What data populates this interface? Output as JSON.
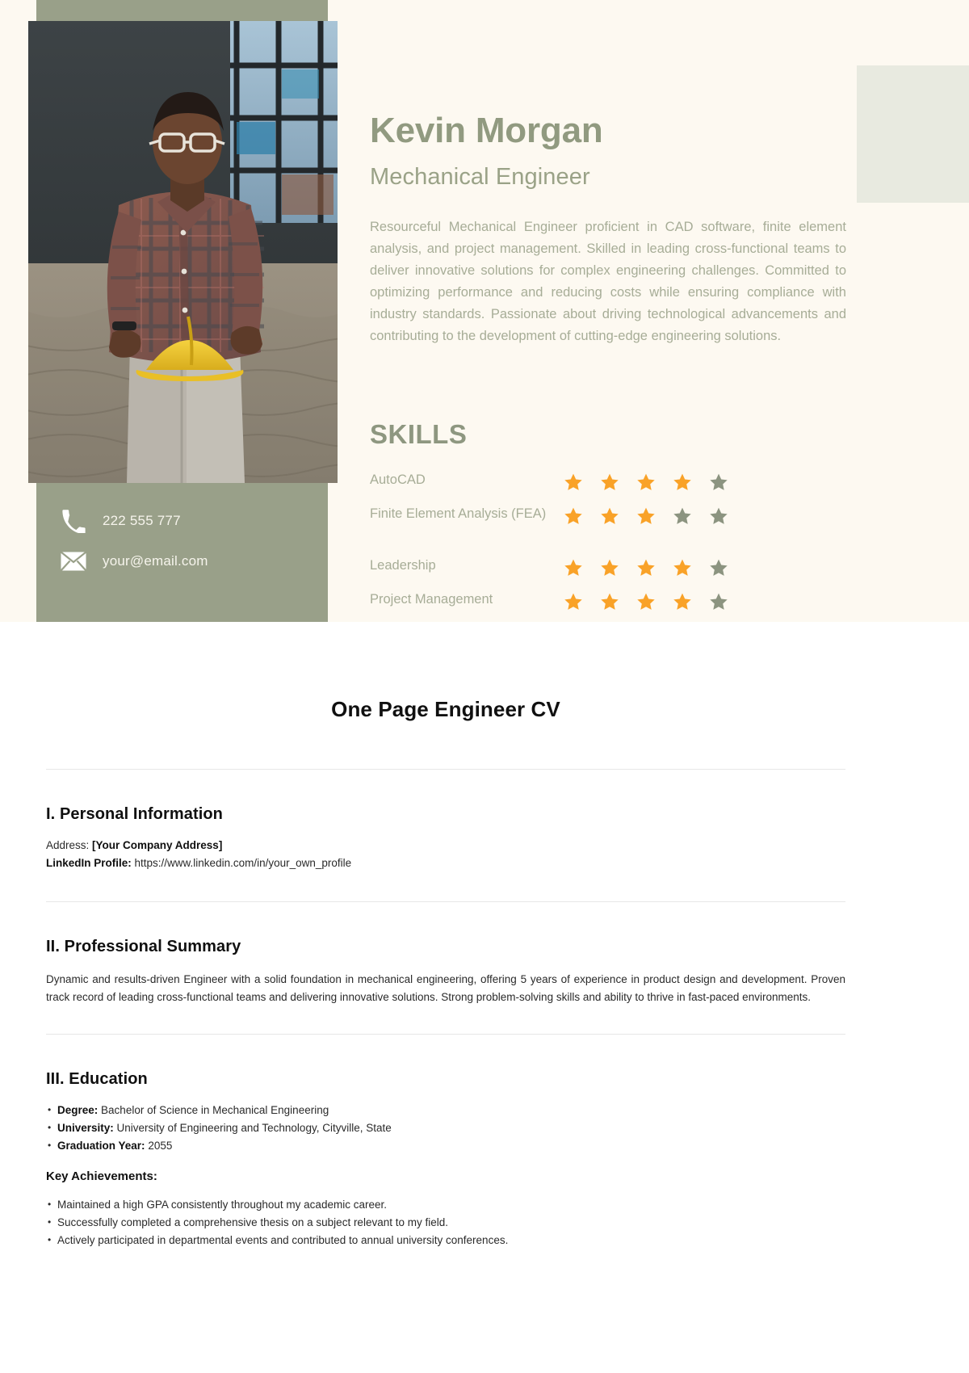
{
  "resume_preview": {
    "name": "Kevin Morgan",
    "role": "Mechanical Engineer",
    "bio": "Resourceful Mechanical Engineer proficient in CAD software, finite element analysis, and project management. Skilled in leading cross-functional teams to deliver innovative solutions for complex engineering challenges. Committed to optimizing performance and reducing costs while ensuring compliance with industry standards. Passionate about driving technological advancements and contributing to the development of cutting-edge engineering solutions.",
    "contact": {
      "phone": "222 555 777",
      "phone_icon": "phone-icon",
      "email": "your@email.com",
      "email_icon": "envelope-icon"
    },
    "skills_heading": "SKILLS",
    "skills": [
      {
        "label": "AutoCAD",
        "rating": 4,
        "max": 5
      },
      {
        "label": "Finite Element Analysis (FEA)",
        "rating": 3,
        "max": 5
      },
      {
        "label": "Leadership",
        "rating": 4,
        "max": 5
      },
      {
        "label": "Project Management",
        "rating": 4,
        "max": 5
      }
    ],
    "colors": {
      "sage": "#99a089",
      "cream": "#fdf9f1",
      "deco": "#e8eae0",
      "star_filled": "#f9a228",
      "star_empty": "#8c9480",
      "heading": "#919a80",
      "body": "#a7ad97"
    }
  },
  "document": {
    "title": "One Page Engineer CV",
    "sections": {
      "personal": {
        "heading": "I. Personal Information",
        "address_label": "Address:",
        "address_value": "[Your Company Address]",
        "linkedin_label": "LinkedIn Profile:",
        "linkedin_value": "https://www.linkedin.com/in/your_own_profile"
      },
      "summary": {
        "heading": "II. Professional Summary",
        "text": "Dynamic and results-driven Engineer with a solid foundation in mechanical engineering, offering 5 years of experience in product design and development. Proven track record of leading cross-functional teams and delivering innovative solutions. Strong problem-solving skills and ability to thrive in fast-paced environments."
      },
      "education": {
        "heading": "III. Education",
        "items": [
          {
            "label": "Degree:",
            "value": "Bachelor of Science in Mechanical Engineering"
          },
          {
            "label": "University:",
            "value": "University of Engineering and Technology, Cityville, State"
          },
          {
            "label": "Graduation Year:",
            "value": "2055"
          }
        ],
        "achievements_heading": "Key Achievements:",
        "achievements": [
          "Maintained a high GPA consistently throughout my academic career.",
          "Successfully completed a comprehensive thesis on a subject relevant to my field.",
          "Actively participated in departmental events and contributed to annual university conferences."
        ]
      }
    }
  }
}
